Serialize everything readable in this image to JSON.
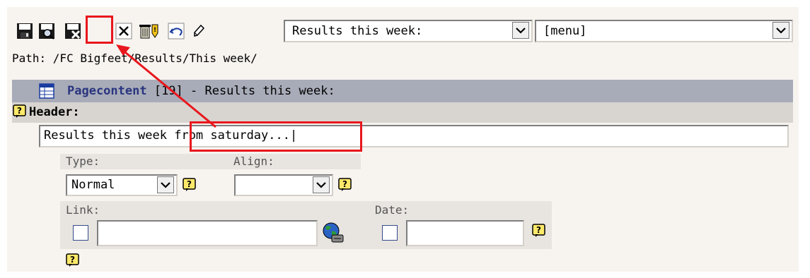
{
  "toolbar": {
    "buttons": [
      {
        "name": "save-icon"
      },
      {
        "name": "save-view-icon"
      },
      {
        "name": "save-close-icon"
      },
      {
        "name": "close-icon"
      },
      {
        "name": "delete-icon"
      },
      {
        "name": "undo-icon"
      },
      {
        "name": "edit-pencil-icon"
      }
    ],
    "page_select": {
      "value": "Results this week:"
    },
    "menu_select": {
      "value": "[menu]"
    }
  },
  "path": {
    "text": "Path: /FC Bigfeet/Results/This week/"
  },
  "section": {
    "title": "Pagecontent",
    "suffix": " [19] - Results this week:"
  },
  "form": {
    "header_label": "Header:",
    "header_value": "Results this week from saturday...|",
    "type": {
      "label": "Type:",
      "value": "Normal"
    },
    "align": {
      "label": "Align:",
      "value": ""
    },
    "link": {
      "label": "Link:",
      "value": ""
    },
    "date": {
      "label": "Date:",
      "value": ""
    }
  },
  "annotation": {
    "color": "#e8171d"
  }
}
